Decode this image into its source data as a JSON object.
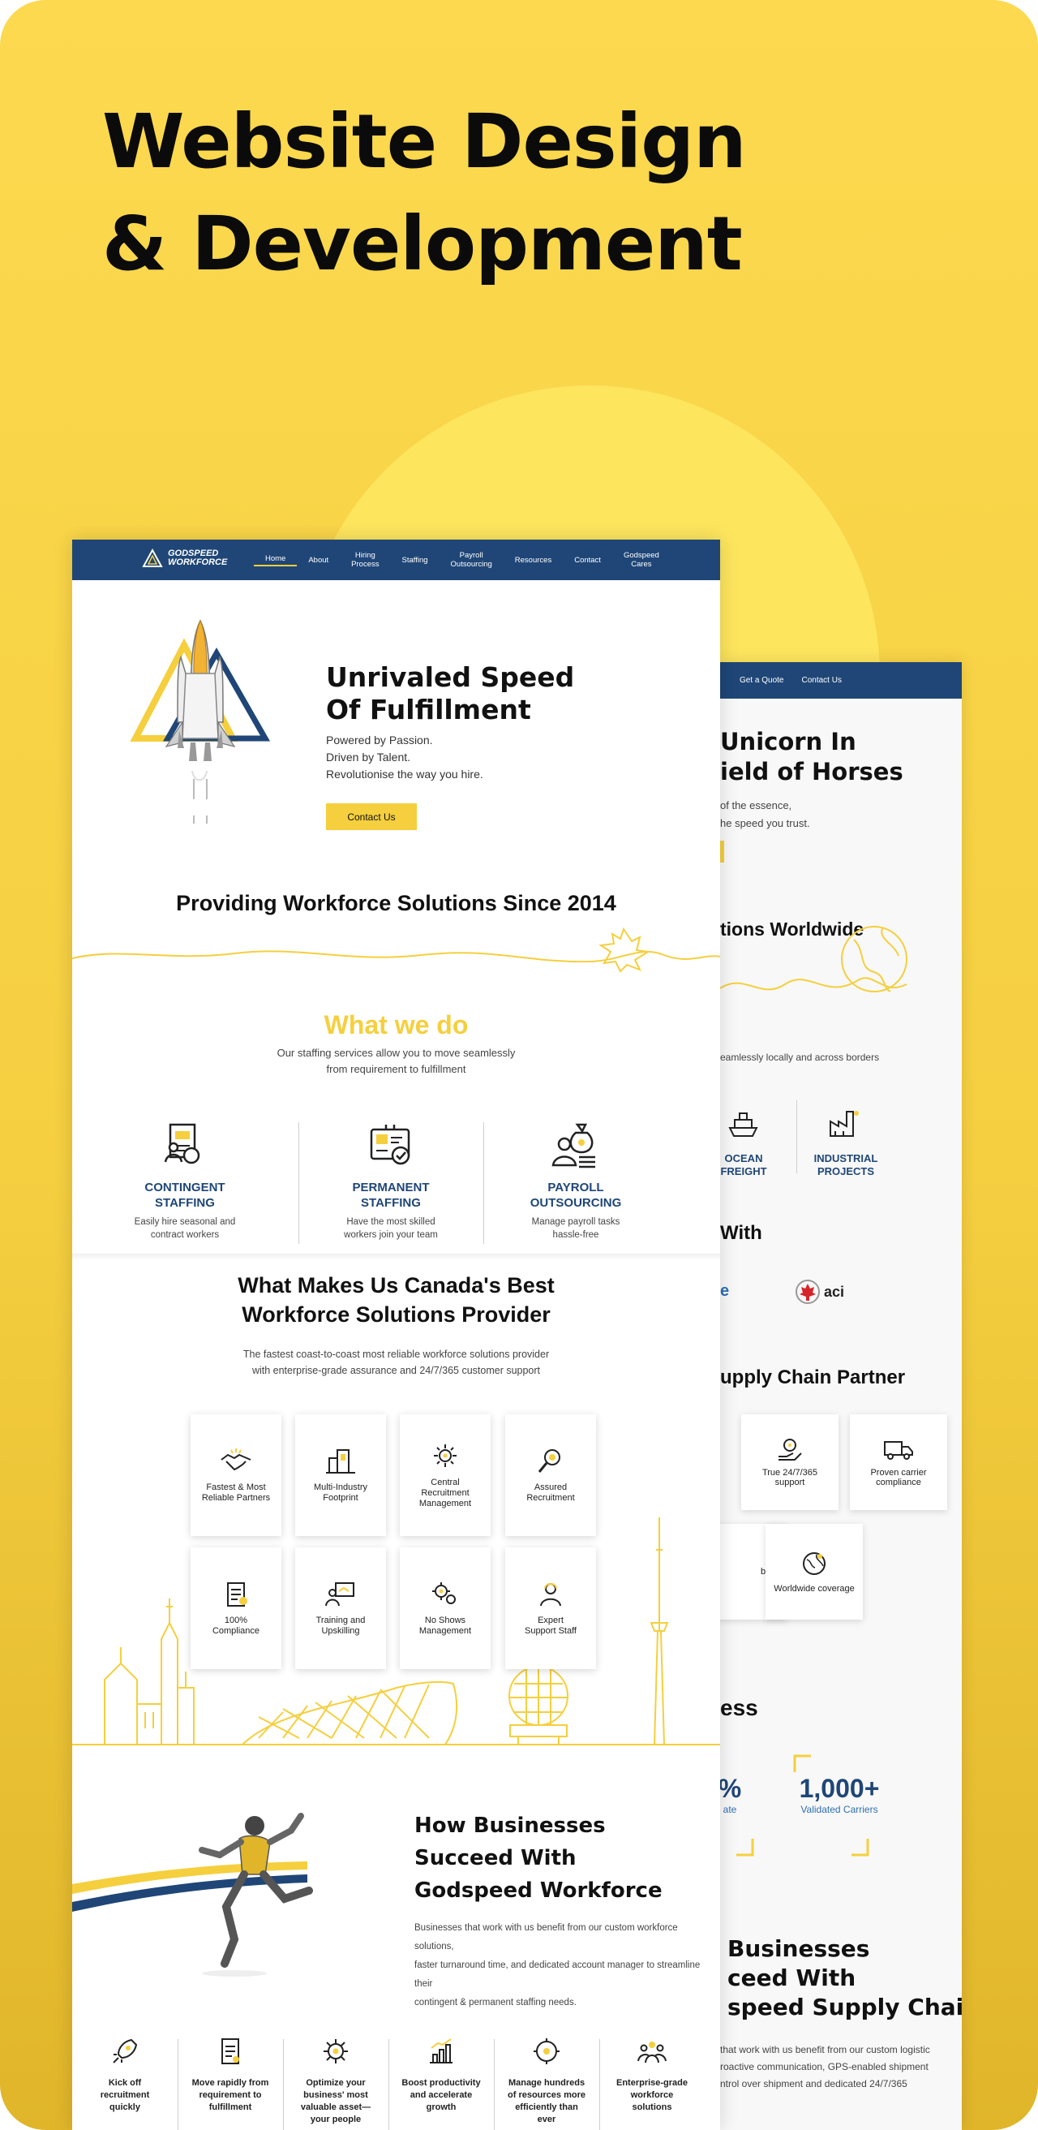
{
  "poster": {
    "title_line1": "Website Design",
    "title_line2": "& Development"
  },
  "front": {
    "logo": {
      "line1": "GODSPEED",
      "line2": "WORKFORCE"
    },
    "nav": [
      {
        "label": "Home",
        "active": true
      },
      {
        "label": "About"
      },
      {
        "label": "Hiring\nProcess"
      },
      {
        "label": "Staffing"
      },
      {
        "label": "Payroll\nOutsourcing"
      },
      {
        "label": "Resources"
      },
      {
        "label": "Contact"
      },
      {
        "label": "Godspeed\nCares"
      }
    ],
    "hero": {
      "title_a": "Unrivaled ",
      "title_b": "Speed",
      "title_c": "Of Fulfillment",
      "line1": "Powered by Passion.",
      "line2": "Driven by Talent.",
      "line3": "Revolutionise the way you hire.",
      "cta": "Contact Us"
    },
    "since": "Providing Workforce Solutions Since 2014",
    "what_we_do": {
      "title": "What we do",
      "sub1": "Our staffing services allow you to move seamlessly",
      "sub2": "from requirement to fulfillment",
      "services": [
        {
          "t1": "CONTINGENT",
          "t2": "STAFFING",
          "d1": "Easily hire seasonal and",
          "d2": "contract workers",
          "icon": "contingent-staffing-icon"
        },
        {
          "t1": "PERMANENT",
          "t2": "STAFFING",
          "d1": "Have the most skilled",
          "d2": "workers join your team",
          "icon": "permanent-staffing-icon"
        },
        {
          "t1": "PAYROLL",
          "t2": "OUTSOURCING",
          "d1": "Manage payroll tasks",
          "d2": "hassle-free",
          "icon": "payroll-icon"
        }
      ]
    },
    "best": {
      "title1": "What Makes Us Canada's Best",
      "title2": "Workforce Solutions Provider",
      "sub1": "The fastest coast-to-coast most reliable workforce solutions provider",
      "sub2": "with enterprise-grade assurance and 24/7/365 customer support",
      "features": [
        {
          "l1": "Fastest & Most",
          "l2": "Reliable Partners",
          "l3": "",
          "icon": "handshake-icon"
        },
        {
          "l1": "Multi-Industry",
          "l2": "Footprint",
          "l3": "",
          "icon": "buildings-icon"
        },
        {
          "l1": "Central",
          "l2": "Recruitment",
          "l3": "Management",
          "icon": "gear-network-icon"
        },
        {
          "l1": "Assured",
          "l2": "Recruitment",
          "l3": "",
          "icon": "magnifier-icon"
        },
        {
          "l1": "100%",
          "l2": "Compliance",
          "l3": "",
          "icon": "clipboard-icon"
        },
        {
          "l1": "Training and",
          "l2": "Upskilling",
          "l3": "",
          "icon": "training-icon"
        },
        {
          "l1": "No Shows",
          "l2": "Management",
          "l3": "",
          "icon": "gears-icon"
        },
        {
          "l1": "Expert",
          "l2": "Support Staff",
          "l3": "",
          "icon": "support-agent-icon"
        }
      ]
    },
    "how": {
      "t1": "How Businesses",
      "t2": "Succeed With",
      "t3": "Godspeed Workforce",
      "p1": "Businesses that work with us benefit from our custom workforce solutions,",
      "p2": "faster turnaround time, and dedicated account manager to streamline their",
      "p3": "contingent & permanent staffing needs."
    },
    "steps": [
      {
        "l1": "Kick off",
        "l2": "recruitment",
        "l3": "quickly",
        "l4": "",
        "icon": "rocket-icon"
      },
      {
        "l1": "Move rapidly from",
        "l2": "requirement to",
        "l3": "fulfillment",
        "l4": "",
        "icon": "document-icon"
      },
      {
        "l1": "Optimize your",
        "l2": "business' most",
        "l3": "valuable asset—",
        "l4": "your people",
        "icon": "gear-icon"
      },
      {
        "l1": "Boost productivity",
        "l2": "and accelerate",
        "l3": "growth",
        "l4": "",
        "icon": "growth-chart-icon"
      },
      {
        "l1": "Manage hundreds",
        "l2": "of resources more",
        "l3": "efficiently than",
        "l4": "ever",
        "icon": "gears-icon"
      },
      {
        "l1": "Enterprise-grade",
        "l2": "workforce",
        "l3": "solutions",
        "l4": "",
        "icon": "team-icon"
      }
    ]
  },
  "back": {
    "nav": [
      "Get a Quote",
      "Contact Us"
    ],
    "hero1": "Unicorn In",
    "hero2": "ield of Horses",
    "hero_p1": "of the essence,",
    "hero_p2": "he speed you trust.",
    "worldwide": "tions Worldwide",
    "borders": "eamlessly locally and across borders",
    "services": [
      {
        "t1": "OCEAN",
        "t2": "FREIGHT",
        "icon": "ship-icon"
      },
      {
        "t1": "INDUSTRIAL",
        "t2": "PROJECTS",
        "icon": "factory-icon"
      }
    ],
    "with": "With",
    "partner_e": "e",
    "aci_logo": "aci",
    "supply_partner": "upply Chain Partner",
    "cards": [
      {
        "l1": "True 24/7/365",
        "l2": "support",
        "icon": "support-hand-icon"
      },
      {
        "l1": "Proven carrier",
        "l2": "compliance",
        "icon": "truck-icon"
      },
      {
        "l1": "bility",
        "l2": "",
        "icon": ""
      },
      {
        "l1": "Worldwide coverage",
        "l2": "",
        "icon": "globe-icon"
      }
    ],
    "ess": "ess",
    "stat1": {
      "v": "%",
      "l": "ate"
    },
    "stat2": {
      "v": "1,000+",
      "l": "Validated Carriers"
    },
    "bottom1": "Businesses",
    "bottom2": "ceed With",
    "bottom3": "speed Supply Chain",
    "bp1": "that work with us benefit from our custom logistic",
    "bp2": "roactive communication, GPS-enabled shipment",
    "bp3": "ntrol over shipment and dedicated 24/7/365"
  },
  "colors": {
    "accent": "#f5cf3e",
    "navy": "#1f4677",
    "poster_bg": "#f8d44a"
  }
}
